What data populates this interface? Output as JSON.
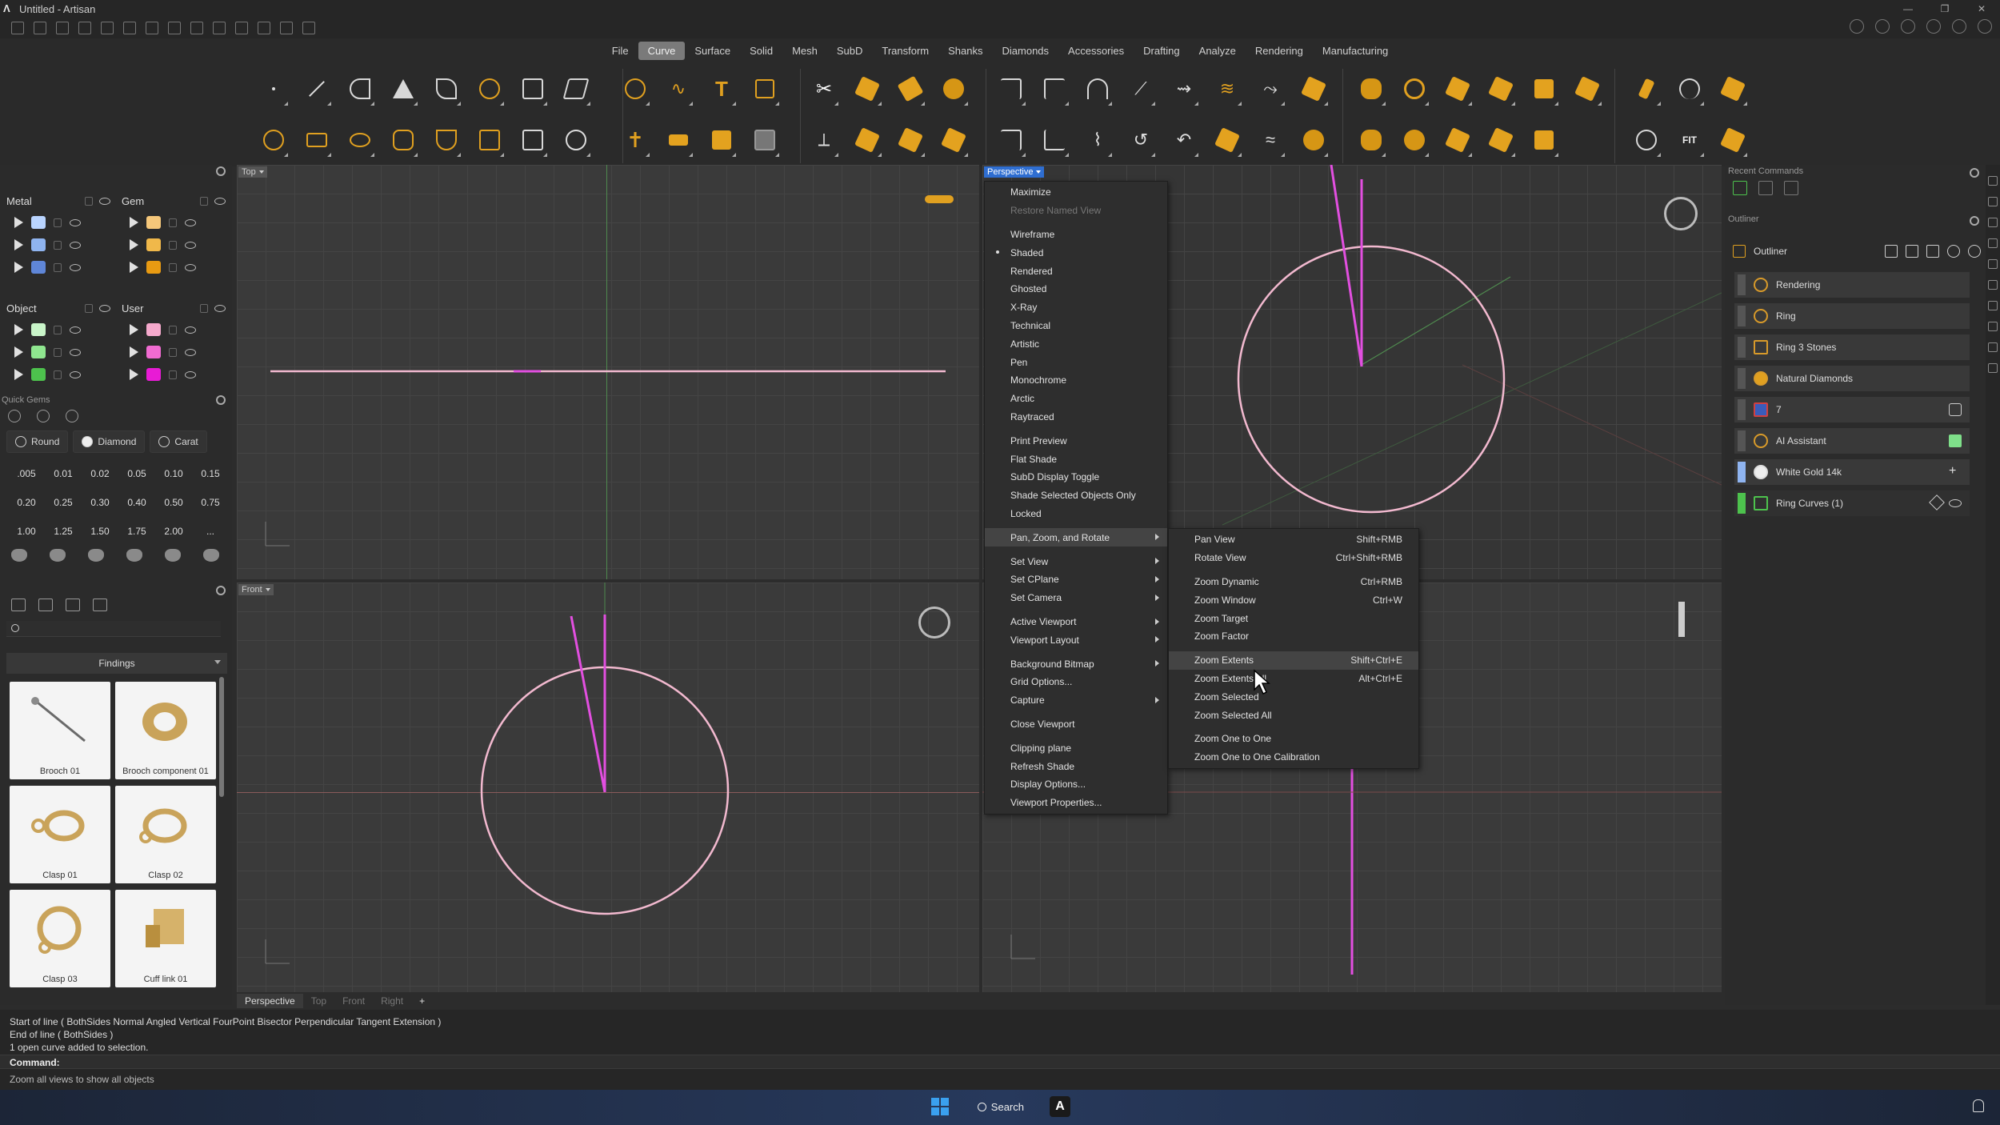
{
  "window": {
    "title": "Untitled - Artisan"
  },
  "menubar": {
    "items": [
      "File",
      "Curve",
      "Surface",
      "Solid",
      "Mesh",
      "SubD",
      "Transform",
      "Shanks",
      "Diamonds",
      "Accessories",
      "Drafting",
      "Analyze",
      "Rendering",
      "Manufacturing"
    ],
    "active": "Curve"
  },
  "layers": {
    "groups": [
      {
        "name": "Metal",
        "colors": [
          "#b9d4ff",
          "#8fb4f0",
          "#5f86d8"
        ]
      },
      {
        "name": "Gem",
        "colors": [
          "#f5c77a",
          "#f0b84a",
          "#e89a12"
        ]
      },
      {
        "name": "Object",
        "colors": [
          "#c9f5c9",
          "#8fe68f",
          "#4dc24d"
        ]
      },
      {
        "name": "User",
        "colors": [
          "#f5a9cc",
          "#f06bd1",
          "#e81bd5"
        ]
      }
    ]
  },
  "quick_gems": {
    "title": "Quick Gems",
    "shape_buttons": [
      "Round",
      "Diamond",
      "Carat"
    ],
    "sizes": [
      ".005",
      "0.01",
      "0.02",
      "0.05",
      "0.10",
      "0.15",
      "0.20",
      "0.25",
      "0.30",
      "0.40",
      "0.50",
      "0.75",
      "1.00",
      "1.25",
      "1.50",
      "1.75",
      "2.00",
      "..."
    ]
  },
  "library": {
    "category": "Findings",
    "items": [
      "Brooch 01",
      "Brooch component 01",
      "Clasp 01",
      "Clasp 02",
      "Clasp 03",
      "Cuff link 01"
    ]
  },
  "viewports": {
    "top_label": "Top",
    "perspective_label": "Perspective",
    "front_label": "Front",
    "tabs": [
      "Perspective",
      "Top",
      "Front",
      "Right"
    ],
    "add_tab": "+"
  },
  "viewport_menu": {
    "items": [
      {
        "label": "Maximize"
      },
      {
        "label": "Restore Named View",
        "disabled": true
      },
      {
        "gap": true
      },
      {
        "label": "Wireframe"
      },
      {
        "label": "Shaded",
        "checked": true
      },
      {
        "label": "Rendered"
      },
      {
        "label": "Ghosted"
      },
      {
        "label": "X-Ray"
      },
      {
        "label": "Technical"
      },
      {
        "label": "Artistic"
      },
      {
        "label": "Pen"
      },
      {
        "label": "Monochrome"
      },
      {
        "label": "Arctic"
      },
      {
        "label": "Raytraced"
      },
      {
        "gap": true
      },
      {
        "label": "Print Preview"
      },
      {
        "label": "Flat Shade"
      },
      {
        "label": "SubD Display Toggle"
      },
      {
        "label": "Shade Selected Objects Only"
      },
      {
        "label": "Locked"
      },
      {
        "gap": true
      },
      {
        "label": "Pan, Zoom, and Rotate",
        "submenu": true,
        "highlighted": true
      },
      {
        "gap": true
      },
      {
        "label": "Set View",
        "submenu": true
      },
      {
        "label": "Set CPlane",
        "submenu": true
      },
      {
        "label": "Set Camera",
        "submenu": true
      },
      {
        "gap": true
      },
      {
        "label": "Active Viewport",
        "submenu": true
      },
      {
        "label": "Viewport Layout",
        "submenu": true
      },
      {
        "gap": true
      },
      {
        "label": "Background Bitmap",
        "submenu": true
      },
      {
        "label": "Grid Options..."
      },
      {
        "label": "Capture",
        "submenu": true
      },
      {
        "gap": true
      },
      {
        "label": "Close Viewport"
      },
      {
        "gap": true
      },
      {
        "label": "Clipping plane"
      },
      {
        "label": "Refresh Shade"
      },
      {
        "label": "Display Options..."
      },
      {
        "label": "Viewport Properties..."
      }
    ]
  },
  "pan_zoom_submenu": {
    "items": [
      {
        "label": "Pan View",
        "shortcut": "Shift+RMB"
      },
      {
        "label": "Rotate View",
        "shortcut": "Ctrl+Shift+RMB"
      },
      {
        "gap": true
      },
      {
        "label": "Zoom Dynamic",
        "shortcut": "Ctrl+RMB"
      },
      {
        "label": "Zoom Window",
        "shortcut": "Ctrl+W"
      },
      {
        "label": "Zoom Target",
        "shortcut": ""
      },
      {
        "label": "Zoom Factor",
        "shortcut": ""
      },
      {
        "gap": true
      },
      {
        "label": "Zoom Extents",
        "shortcut": "Shift+Ctrl+E",
        "highlighted": true
      },
      {
        "label": "Zoom Extents All",
        "shortcut": "Alt+Ctrl+E"
      },
      {
        "label": "Zoom Selected",
        "shortcut": ""
      },
      {
        "label": "Zoom Selected All",
        "shortcut": ""
      },
      {
        "gap": true
      },
      {
        "label": "Zoom One to One",
        "shortcut": ""
      },
      {
        "label": "Zoom One to One Calibration",
        "shortcut": ""
      }
    ]
  },
  "right_panel": {
    "recent_commands_title": "Recent Commands",
    "outliner_title": "Outliner",
    "outliner_label": "Outliner",
    "items": [
      {
        "label": "Rendering",
        "bar": "#555555"
      },
      {
        "label": "Ring",
        "bar": "#555555"
      },
      {
        "label": "Ring 3 Stones",
        "bar": "#555555"
      },
      {
        "label": "Natural Diamonds",
        "bar": "#555555"
      },
      {
        "label": "7",
        "bar": "#555555"
      },
      {
        "label": "AI Assistant",
        "bar": "#555555"
      },
      {
        "label": "White Gold 14k",
        "bar": "#8fb4f0"
      },
      {
        "label": "Ring Curves (1)",
        "bar": "#4dc24d"
      }
    ]
  },
  "command_history": [
    "Start of line ( BothSides  Normal  Angled  Vertical  FourPoint  Bisector  Perpendicular  Tangent  Extension )",
    "End of line ( BothSides )",
    "1 open curve added to selection."
  ],
  "command_prompt": "Command:",
  "status_text": "Zoom all views to show all objects",
  "taskbar": {
    "search_label": "Search",
    "app_letter": "A"
  }
}
